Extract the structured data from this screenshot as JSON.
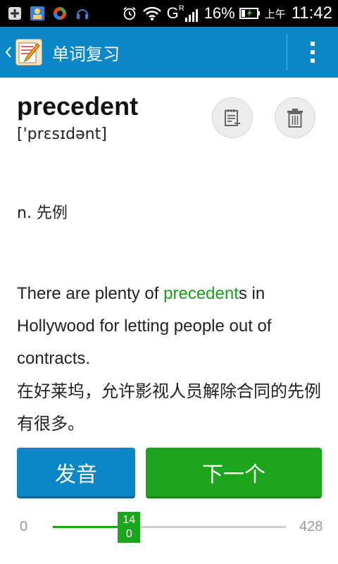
{
  "status_bar": {
    "signal_letter": "G",
    "signal_sub": "R",
    "battery_percent": "16%",
    "time_prefix": "上午",
    "time": "11:42"
  },
  "app_bar": {
    "title": "单词复习",
    "back_icon": "chevron-left-icon",
    "overflow_icon": "more-vert-icon"
  },
  "word": {
    "headword": "precedent",
    "phonetic": "['prɛsɪdənt]",
    "definition": "n. 先例"
  },
  "example": {
    "before": "There are plenty of ",
    "highlight": "precedent",
    "after": "s in Hollywood for letting people out of contracts.",
    "translation": "在好莱坞，允许影视人员解除合同的先例有很多。"
  },
  "actions": {
    "add_to_notebook_icon": "notebook-add-icon",
    "delete_icon": "trash-icon",
    "speak_label": "发音",
    "next_label": "下一个"
  },
  "progress": {
    "min": "0",
    "max": "428",
    "current": 140,
    "current_label_line1": "14",
    "current_label_line2": "0"
  },
  "colors": {
    "primary_blue": "#0b86c7",
    "accent_green": "#1ea51e",
    "highlight_green": "#1aa31a"
  }
}
